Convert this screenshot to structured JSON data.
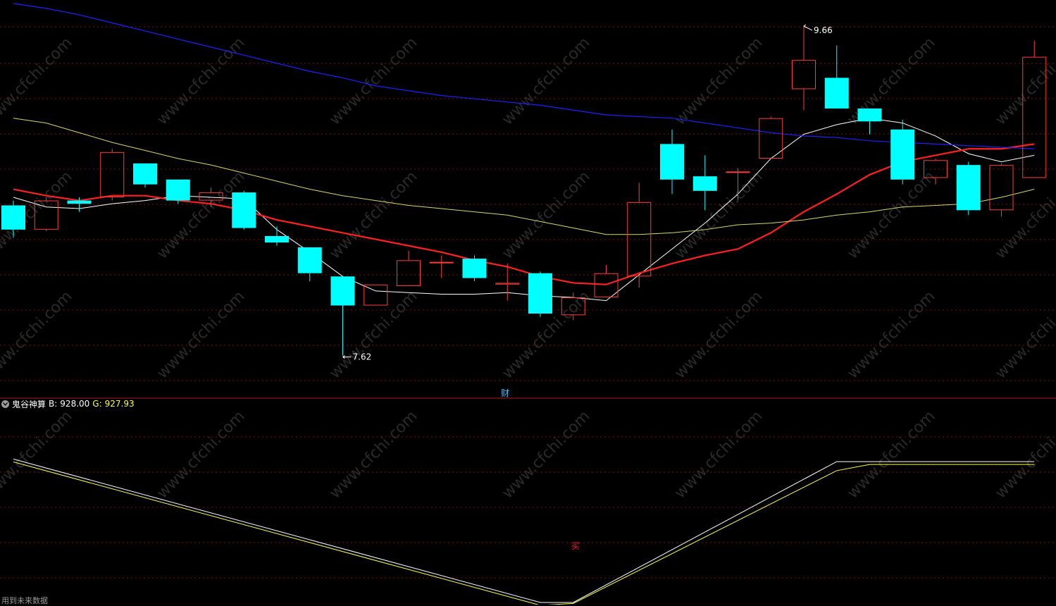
{
  "indicator": {
    "name": "鬼谷神算",
    "b_label": "B:",
    "b_value": "928.00",
    "g_label": "G:",
    "g_value": "927.93"
  },
  "annotations": {
    "high": "9.66",
    "low": "7.62",
    "finance_marker": "财",
    "buy_marker": "买",
    "footnote": "用到未来数据"
  },
  "watermark": "www.cfchi.com",
  "colors": {
    "background": "#000000",
    "up_candle": "#ff3c3c",
    "down_candle": "#00ffff",
    "ma_white": "#ffffff",
    "ma_red": "#ff2020",
    "ma_yellow": "#d8d860",
    "ma_blue": "#2020ff",
    "grid": "#7a1010",
    "separator": "#b01818",
    "b_line": "#ffffff",
    "g_line": "#ffff40"
  },
  "chart_data": [
    {
      "type": "candlestick",
      "panel": "price",
      "ylim": [
        7.4,
        9.8
      ],
      "candles": [
        {
          "o": 8.55,
          "h": 8.58,
          "l": 8.35,
          "c": 8.4
        },
        {
          "o": 8.4,
          "h": 8.6,
          "l": 8.39,
          "c": 8.58
        },
        {
          "o": 8.58,
          "h": 8.6,
          "l": 8.51,
          "c": 8.56
        },
        {
          "o": 8.6,
          "h": 8.9,
          "l": 8.58,
          "c": 8.88
        },
        {
          "o": 8.81,
          "h": 8.81,
          "l": 8.66,
          "c": 8.68
        },
        {
          "o": 8.71,
          "h": 8.71,
          "l": 8.56,
          "c": 8.58
        },
        {
          "o": 8.58,
          "h": 8.66,
          "l": 8.54,
          "c": 8.63
        },
        {
          "o": 8.63,
          "h": 8.64,
          "l": 8.4,
          "c": 8.41
        },
        {
          "o": 8.36,
          "h": 8.42,
          "l": 8.3,
          "c": 8.32
        },
        {
          "o": 8.29,
          "h": 8.29,
          "l": 8.08,
          "c": 8.13
        },
        {
          "o": 8.11,
          "h": 8.11,
          "l": 7.62,
          "c": 7.93
        },
        {
          "o": 7.93,
          "h": 8.06,
          "l": 7.93,
          "c": 8.06
        },
        {
          "o": 8.05,
          "h": 8.27,
          "l": 8.05,
          "c": 8.21
        },
        {
          "o": 8.2,
          "h": 8.24,
          "l": 8.1,
          "c": 8.2
        },
        {
          "o": 8.22,
          "h": 8.24,
          "l": 8.08,
          "c": 8.1
        },
        {
          "o": 8.06,
          "h": 8.19,
          "l": 7.96,
          "c": 8.07
        },
        {
          "o": 8.13,
          "h": 8.14,
          "l": 7.86,
          "c": 7.88
        },
        {
          "o": 7.87,
          "h": 8.01,
          "l": 7.84,
          "c": 7.98
        },
        {
          "o": 7.98,
          "h": 8.18,
          "l": 7.98,
          "c": 8.13
        },
        {
          "o": 8.11,
          "h": 8.69,
          "l": 8.04,
          "c": 8.57
        },
        {
          "o": 8.93,
          "h": 9.02,
          "l": 8.62,
          "c": 8.71
        },
        {
          "o": 8.73,
          "h": 8.86,
          "l": 8.52,
          "c": 8.64
        },
        {
          "o": 8.76,
          "h": 8.78,
          "l": 8.58,
          "c": 8.76
        },
        {
          "o": 8.84,
          "h": 9.1,
          "l": 8.84,
          "c": 9.09
        },
        {
          "o": 9.27,
          "h": 9.66,
          "l": 9.14,
          "c": 9.45
        },
        {
          "o": 9.34,
          "h": 9.54,
          "l": 9.16,
          "c": 9.15
        },
        {
          "o": 9.15,
          "h": 9.15,
          "l": 8.99,
          "c": 9.07
        },
        {
          "o": 9.02,
          "h": 9.08,
          "l": 8.68,
          "c": 8.71
        },
        {
          "o": 8.72,
          "h": 8.84,
          "l": 8.68,
          "c": 8.83
        },
        {
          "o": 8.8,
          "h": 8.82,
          "l": 8.49,
          "c": 8.52
        },
        {
          "o": 8.52,
          "h": 8.81,
          "l": 8.48,
          "c": 8.8
        },
        {
          "o": 8.72,
          "h": 9.57,
          "l": 8.72,
          "c": 9.47
        }
      ],
      "series": [
        {
          "values": [
            8.6,
            8.54,
            8.53,
            8.56,
            8.58,
            8.61,
            8.6,
            8.59,
            8.4,
            8.26,
            8.11,
            8.02,
            8.01,
            8.0,
            8.0,
            8.01,
            7.99,
            7.98,
            7.96,
            8.12,
            8.28,
            8.44,
            8.62,
            8.84,
            8.99,
            9.05,
            9.09,
            9.06,
            8.98,
            8.87,
            8.82,
            8.86
          ]
        },
        {
          "values": [
            8.65,
            8.61,
            8.58,
            8.61,
            8.61,
            8.58,
            8.56,
            8.52,
            8.46,
            8.42,
            8.38,
            8.34,
            8.3,
            8.26,
            8.21,
            8.17,
            8.11,
            8.07,
            8.06,
            8.13,
            8.19,
            8.24,
            8.28,
            8.38,
            8.51,
            8.62,
            8.74,
            8.82,
            8.86,
            8.9,
            8.9,
            8.93
          ]
        },
        {
          "values": [
            9.09,
            9.06,
            9.0,
            8.94,
            8.89,
            8.84,
            8.8,
            8.75,
            8.7,
            8.65,
            8.61,
            8.58,
            8.55,
            8.53,
            8.51,
            8.49,
            8.45,
            8.41,
            8.37,
            8.37,
            8.38,
            8.4,
            8.43,
            8.44,
            8.46,
            8.49,
            8.51,
            8.54,
            8.55,
            8.56,
            8.6,
            8.65
          ]
        },
        {
          "values": [
            9.8,
            9.77,
            9.73,
            9.68,
            9.63,
            9.58,
            9.53,
            9.48,
            9.43,
            9.38,
            9.34,
            9.29,
            9.26,
            9.23,
            9.21,
            9.19,
            9.17,
            9.14,
            9.11,
            9.1,
            9.09,
            9.06,
            9.03,
            9.0,
            8.98,
            8.97,
            8.95,
            8.94,
            8.93,
            8.92,
            8.91,
            8.9
          ]
        }
      ]
    },
    {
      "type": "line",
      "panel": "indicator",
      "ylim": [
        0,
        1300
      ],
      "x": [
        0,
        16,
        17,
        25,
        26,
        31
      ],
      "series": [
        {
          "name": "B",
          "values": [
            1150,
            0,
            0,
            1130,
            1130,
            1130
          ]
        },
        {
          "name": "G",
          "values": [
            1150,
            0,
            15,
            1080,
            1130,
            1130
          ]
        }
      ]
    }
  ]
}
